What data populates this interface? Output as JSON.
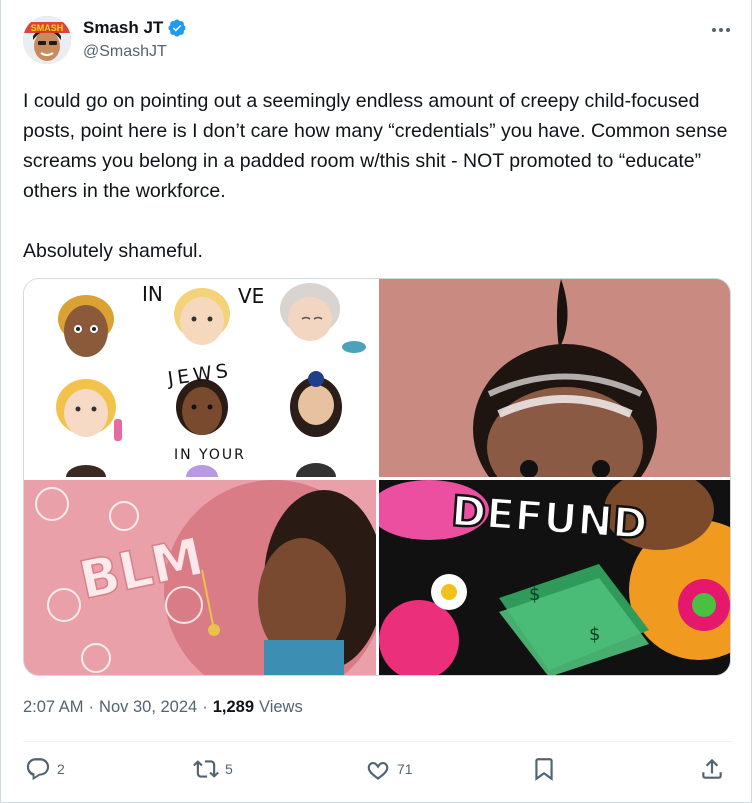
{
  "author": {
    "display_name": "Smash JT",
    "handle": "@SmashJT",
    "avatar_badge_text": "SMASH",
    "verified": true
  },
  "tweet": {
    "text": "I could go on pointing out a seemingly endless amount of creepy child-focused posts, point here is I don’t care how many “credentials” you have. Common sense screams you belong in a padded room w/this shit - NOT promoted to “educate” others in the workforce.\n\nAbsolutely shameful."
  },
  "media": {
    "image1": {
      "text_top_left": "IN",
      "text_top_right": "VE",
      "text_middle": "JEWS",
      "text_bottom": "IN YOUR"
    },
    "image2": {},
    "image3": {
      "text_bubbles": "BLM"
    },
    "image4": {
      "text_banner": "DEFUND"
    }
  },
  "meta": {
    "time": "2:07 AM",
    "separator": "·",
    "date": "Nov 30, 2024",
    "views_count": "1,289",
    "views_label": "Views"
  },
  "actions": {
    "reply_count": "2",
    "retweet_count": "5",
    "like_count": "71"
  },
  "colors": {
    "verified_blue": "#1d9bf0",
    "secondary_text": "#536471",
    "primary_text": "#0f1419",
    "border": "#cfd9de"
  },
  "icons": [
    "verified-badge-icon",
    "more-icon",
    "reply-icon",
    "retweet-icon",
    "like-icon",
    "bookmark-icon",
    "share-icon"
  ]
}
